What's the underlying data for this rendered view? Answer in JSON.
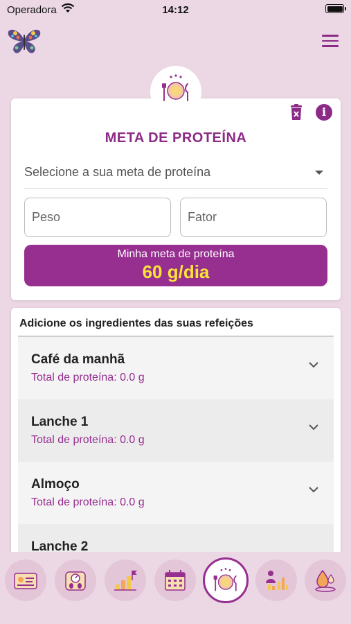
{
  "status_bar": {
    "carrier": "Operadora",
    "time": "14:12"
  },
  "icons": {
    "logo": "butterfly-logo",
    "menu": "hamburger-menu-icon",
    "section": "plate-utensils-icon",
    "delete": "trash-icon",
    "info": "info-icon"
  },
  "colors": {
    "accent": "#962f8f",
    "highlight": "#fbe33a",
    "background": "#ecd7e4"
  },
  "protein_card": {
    "title": "META DE PROTEÍNA",
    "info_glyph": "i",
    "select_placeholder": "Selecione a sua meta de proteína",
    "weight_placeholder": "Peso",
    "factor_placeholder": "Fator",
    "goal_label": "Minha meta de proteína",
    "goal_value": "60 g/dia"
  },
  "meals_card": {
    "header": "Adicione os ingredientes das suas refeições",
    "meals": [
      {
        "name": "Café da manhã",
        "total": "Total de proteína: 0.0 g"
      },
      {
        "name": "Lanche 1",
        "total": "Total de proteína: 0.0 g"
      },
      {
        "name": "Almoço",
        "total": "Total de proteína: 0.0 g"
      },
      {
        "name": "Lanche 2",
        "total": ""
      }
    ]
  },
  "bottom_nav": {
    "items": [
      {
        "icon": "id-card-icon",
        "active": false
      },
      {
        "icon": "scale-icon",
        "active": false
      },
      {
        "icon": "progress-chart-flag-icon",
        "active": false
      },
      {
        "icon": "calendar-icon",
        "active": false
      },
      {
        "icon": "plate-utensils-icon",
        "active": true
      },
      {
        "icon": "people-chart-icon",
        "active": false
      },
      {
        "icon": "water-drop-icon",
        "active": false
      }
    ]
  }
}
